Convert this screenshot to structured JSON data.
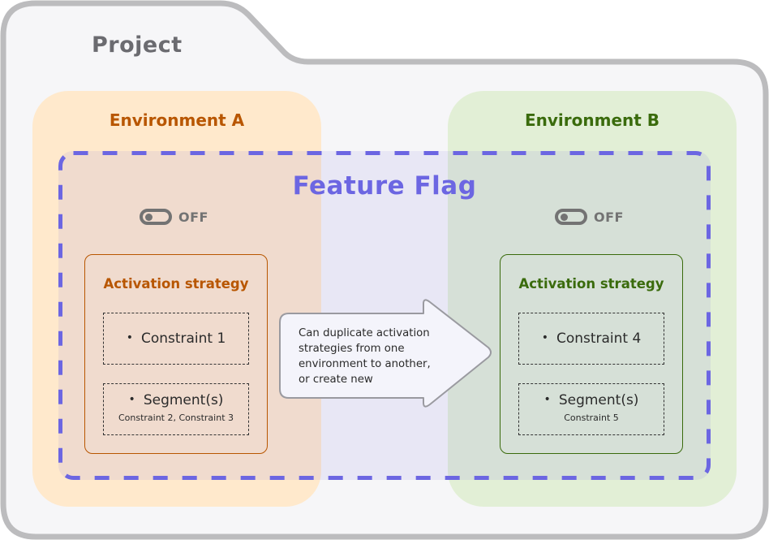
{
  "project": {
    "title": "Project"
  },
  "colors": {
    "project_border": "#bcbcbe",
    "project_fill": "#f6f6f8",
    "env_a_fill": "#ffe9cc",
    "env_a_accent": "#b85600",
    "env_b_fill": "#e2efd6",
    "env_b_accent": "#3a6b0c",
    "flag_accent": "#6c66e2",
    "toggle_gray": "#737373"
  },
  "feature_flag": {
    "title": "Feature Flag"
  },
  "environments": [
    {
      "name": "Environment A",
      "toggle": {
        "state": "OFF"
      },
      "strategy": {
        "title": "Activation strategy",
        "constraint": {
          "label": "Constraint 1"
        },
        "segment": {
          "label": "Segment(s)",
          "details": "Constraint 2, Constraint 3"
        }
      }
    },
    {
      "name": "Environment B",
      "toggle": {
        "state": "OFF"
      },
      "strategy": {
        "title": "Activation strategy",
        "constraint": {
          "label": "Constraint 4"
        },
        "segment": {
          "label": "Segment(s)",
          "details": "Constraint 5"
        }
      }
    }
  ],
  "arrow": {
    "lines": [
      "Can duplicate activation",
      "strategies from one",
      "environment to another,",
      "or create new"
    ]
  },
  "bullet_glyph": "•"
}
